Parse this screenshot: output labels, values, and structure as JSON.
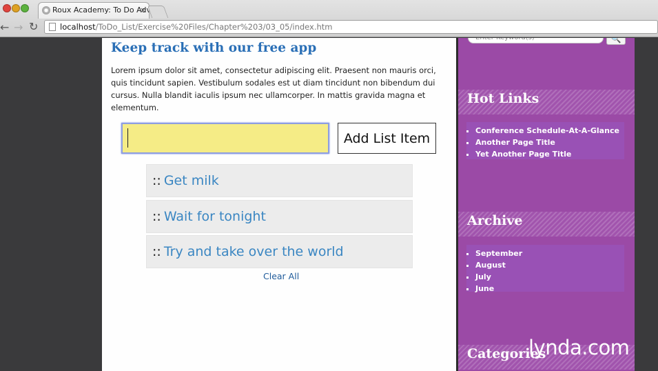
{
  "browser": {
    "tab_title": "Roux Academy: To Do Advanced",
    "tab_close": "×",
    "url_host": "localhost",
    "url_path": "/ToDo_List/Exercise%20Files/Chapter%203/03_05/index.htm",
    "back_icon": "←",
    "forward_icon": "→",
    "reload_icon": "↻"
  },
  "main": {
    "title": "Keep track with our free app",
    "intro": "Lorem ipsum dolor sit amet, consectetur adipiscing elit. Praesent non mauris orci, quis tincidunt sapien. Vestibulum sodales est ut diam tincidunt non bibendum dui cursus. Nulla blandit iaculis ipsum nec ullamcorper. In mattis gravida magna et elementum.",
    "input_value": "",
    "add_button_label": "Add List Item",
    "item_prefix": "::",
    "items": [
      {
        "label": "Get milk"
      },
      {
        "label": "Wait for tonight"
      },
      {
        "label": "Try and take over the world"
      }
    ],
    "clear_all_label": "Clear All"
  },
  "sidebar": {
    "search_placeholder": "Enter Keyword(s)",
    "search_icon": "🔍",
    "hot_links_title": "Hot Links",
    "hot_links": [
      "Conference Schedule-At-A-Glance",
      "Another Page Title",
      "Yet Another Page Title"
    ],
    "archive_title": "Archive",
    "archive": [
      "September",
      "August",
      "July",
      "June"
    ],
    "categories_title": "Categories"
  },
  "watermark": "lynda.com",
  "colors": {
    "title_blue": "#2a6fb6",
    "link_blue": "#3a86c2",
    "input_yellow": "#f5ec86",
    "sidebar_purple": "#9b4aa6"
  }
}
